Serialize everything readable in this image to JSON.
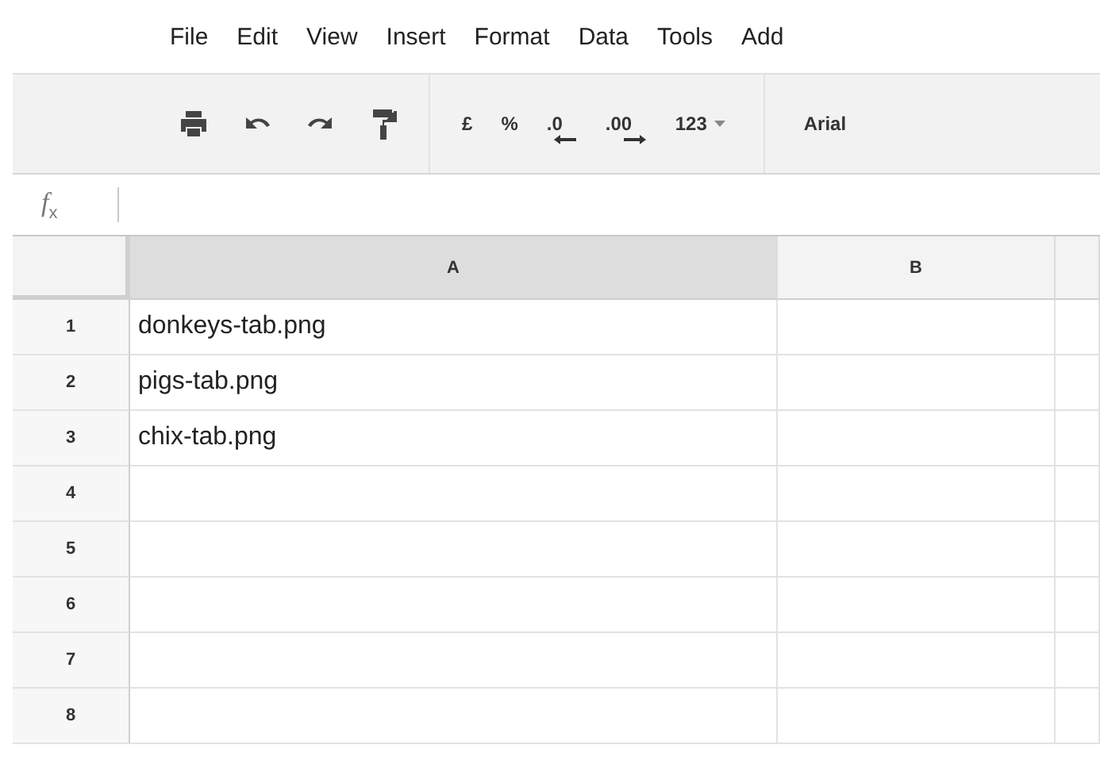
{
  "menu": [
    "File",
    "Edit",
    "View",
    "Insert",
    "Format",
    "Data",
    "Tools",
    "Add"
  ],
  "toolbar": {
    "number_buttons": [
      {
        "kind": "text",
        "label": "£"
      },
      {
        "kind": "text",
        "label": "%"
      },
      {
        "kind": "decrease",
        "label": ".0"
      },
      {
        "kind": "increase",
        "label": ".00"
      },
      {
        "kind": "dropdown",
        "label": "123"
      }
    ],
    "font": "Arial"
  },
  "formula_bar": {
    "label": "f$_{x}$"
  },
  "columns": [
    {
      "label": "A",
      "selected": true
    },
    {
      "label": "B",
      "selected": false
    }
  ],
  "rows": [
    {
      "number": "1",
      "a": "donkeys-tab.png"
    },
    {
      "number": "2",
      "a": "pigs-tab.png"
    },
    {
      "number": "3",
      "a": "chix-tab.png"
    },
    {
      "number": "4"
    },
    {
      "number": "5"
    },
    {
      "number": "6"
    },
    {
      "number": "7"
    },
    {
      "number": "8"
    }
  ]
}
